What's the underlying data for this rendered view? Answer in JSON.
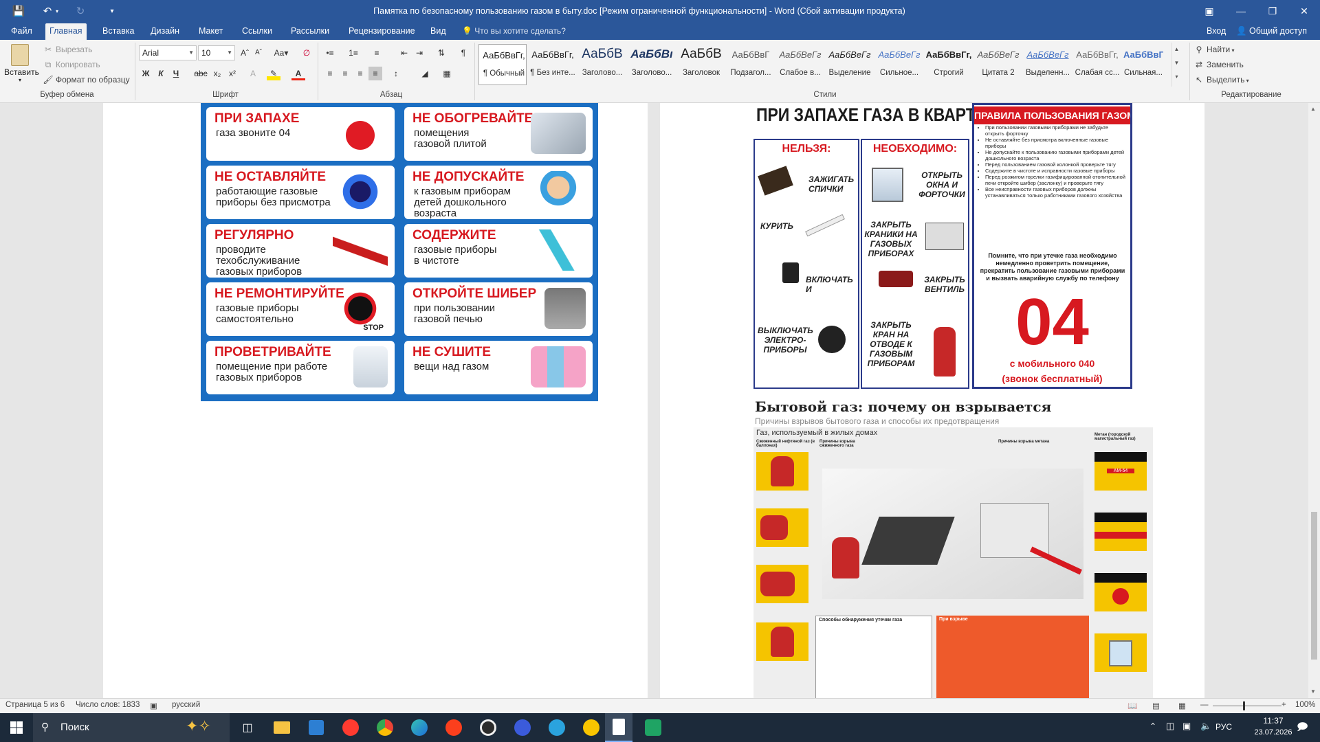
{
  "window": {
    "title": "Памятка по безопасному пользованию газом в быту.doc [Режим ограниченной функциональности] - Word (Сбой активации продукта)"
  },
  "tabs": [
    {
      "label": "Файл"
    },
    {
      "label": "Главная"
    },
    {
      "label": "Вставка"
    },
    {
      "label": "Дизайн"
    },
    {
      "label": "Макет"
    },
    {
      "label": "Ссылки"
    },
    {
      "label": "Рассылки"
    },
    {
      "label": "Рецензирование"
    },
    {
      "label": "Вид"
    }
  ],
  "tellme": "Что вы хотите сделать?",
  "signin": "Вход",
  "share": "Общий доступ",
  "clipboard": {
    "paste": "Вставить",
    "cut": "Вырезать",
    "copy": "Копировать",
    "format_painter": "Формат по образцу",
    "group": "Буфер обмена"
  },
  "font": {
    "name": "Arial",
    "size": "10",
    "group": "Шрифт"
  },
  "paragraph": {
    "group": "Абзац"
  },
  "styles": {
    "group": "Стили",
    "items": [
      {
        "sample": "АаБбВвГг,",
        "name": "¶ Обычный"
      },
      {
        "sample": "АаБбВвГг,",
        "name": "¶ Без инте..."
      },
      {
        "sample": "АаБбВ",
        "name": "Заголово..."
      },
      {
        "sample": "АаБбВı",
        "name": "Заголово..."
      },
      {
        "sample": "АаБбВ",
        "name": "Заголовок"
      },
      {
        "sample": "АаБбВвГ",
        "name": "Подзагол..."
      },
      {
        "sample": "АаБбВеГг",
        "name": "Слабое в..."
      },
      {
        "sample": "АаБбВеГг",
        "name": "Выделение"
      },
      {
        "sample": "АаБбВеГг",
        "name": "Сильное..."
      },
      {
        "sample": "АаБбВвГг,",
        "name": "Строгий"
      },
      {
        "sample": "АаБбВеГг",
        "name": "Цитата 2"
      },
      {
        "sample": "АаБбВеГг",
        "name": "Выделенн..."
      },
      {
        "sample": "АаБбВвГг,",
        "name": "Слабая сс..."
      },
      {
        "sample": "АаБбВвГг,",
        "name": "Сильная..."
      }
    ]
  },
  "editing": {
    "find": "Найти",
    "replace": "Заменить",
    "select": "Выделить",
    "group": "Редактирование"
  },
  "poster_left": {
    "cards": [
      {
        "head": "ПРИ ЗАПАХЕ",
        "text": "газа звоните 04"
      },
      {
        "head": "НЕ ОБОГРЕВАЙТЕ",
        "text": "помещения\nгазовой плитой"
      },
      {
        "head": "НЕ ОСТАВЛЯЙТЕ",
        "text": "работающие газовые\nприборы без присмотра"
      },
      {
        "head": "НЕ ДОПУСКАЙТЕ",
        "text": "к газовым приборам\nдетей дошкольного\nвозраста"
      },
      {
        "head": "РЕГУЛЯРНО",
        "text": "проводите\nтехобслуживание\nгазовых приборов"
      },
      {
        "head": "СОДЕРЖИТЕ",
        "text": "газовые приборы\nв чистоте"
      },
      {
        "head": "НЕ РЕМОНТИРУЙТЕ",
        "text": "газовые приборы\nсамостоятельно"
      },
      {
        "head": "ОТКРОЙТЕ ШИБЕР",
        "text": "при пользовании\nгазовой печью"
      },
      {
        "head": "ПРОВЕТРИВАЙТЕ",
        "text": "помещение при работе\nгазовых приборов"
      },
      {
        "head": "НЕ СУШИТЕ",
        "text": "вещи над газом"
      }
    ],
    "stop": "STOP"
  },
  "poster_right": {
    "title": "ПРИ ЗАПАХЕ ГАЗА В КВАРТИРЕ:",
    "rules_title": "ПРАВИЛА ПОЛЬЗОВАНИЯ ГАЗОМ",
    "col_forbidden": "НЕЛЬЗЯ:",
    "col_needed": "НЕОБХОДИМО:",
    "forbidden": [
      "ЗАЖИГАТЬ СПИЧКИ",
      "КУРИТЬ",
      "ВКЛЮЧАТЬ И",
      "ВЫКЛЮЧАТЬ ЭЛЕКТРО-ПРИБОРЫ"
    ],
    "needed": [
      "ОТКРЫТЬ ОКНА И ФОРТОЧКИ",
      "ЗАКРЫТЬ КРАНИКИ НА ГАЗОВЫХ ПРИБОРАХ",
      "ЗАКРЫТЬ ВЕНТИЛЬ",
      "ЗАКРЫТЬ КРАН НА ОТВОДЕ К ГАЗОВЫМ ПРИБОРАМ"
    ],
    "rules": [
      "При пользовании газовыми приборами не забудьте открыть форточку",
      "Не оставляйте без присмотра включенные газовые приборы",
      "Не допускайте к пользованию газовыми приборами детей дошкольного возраста",
      "Перед пользованием газовой колонкой проверьте тягу",
      "Содержите в чистоте и исправности газовые приборы",
      "Перед розжигом горелки газифицированной отопительной печи откройте шибер (заслонку) и проверьте тягу",
      "Все неисправности газовых приборов должны устанавливаться только работниками газового хозяйства"
    ],
    "remember": "Помните, что при утечке газа необходимо немедленно проветрить помещение, прекратить пользование газовыми приборами и вызвать аварийную службу по телефону",
    "number": "04",
    "mobile": "с мобильного 040",
    "free": "(звонок бесплатный)"
  },
  "infographic": {
    "title": "Бытовой газ: почему он взрывается",
    "subtitle": "Причины взрывов бытового газа и способы их предотвращения",
    "section": "Газ, используемый в жилых домах",
    "lpg": "Сжиженный нефтяной газ (в баллонах)",
    "causes_lpg": "Причины взрыва сжиженного газа",
    "causes_methane": "Причины взрыва метана",
    "methane": "Метан (городской магистральный газ)",
    "detect": "Способы обнаружения утечки газа",
    "on_explosion": "При взрыве",
    "bottle": "АМ-54"
  },
  "status": {
    "page": "Страница 5 из 6",
    "words": "Число слов: 1833",
    "lang": "русский",
    "zoom": "100%"
  },
  "taskbar": {
    "search": "Поиск",
    "lang": "РУС",
    "time": "11:37",
    "date": "23.07.2026"
  }
}
